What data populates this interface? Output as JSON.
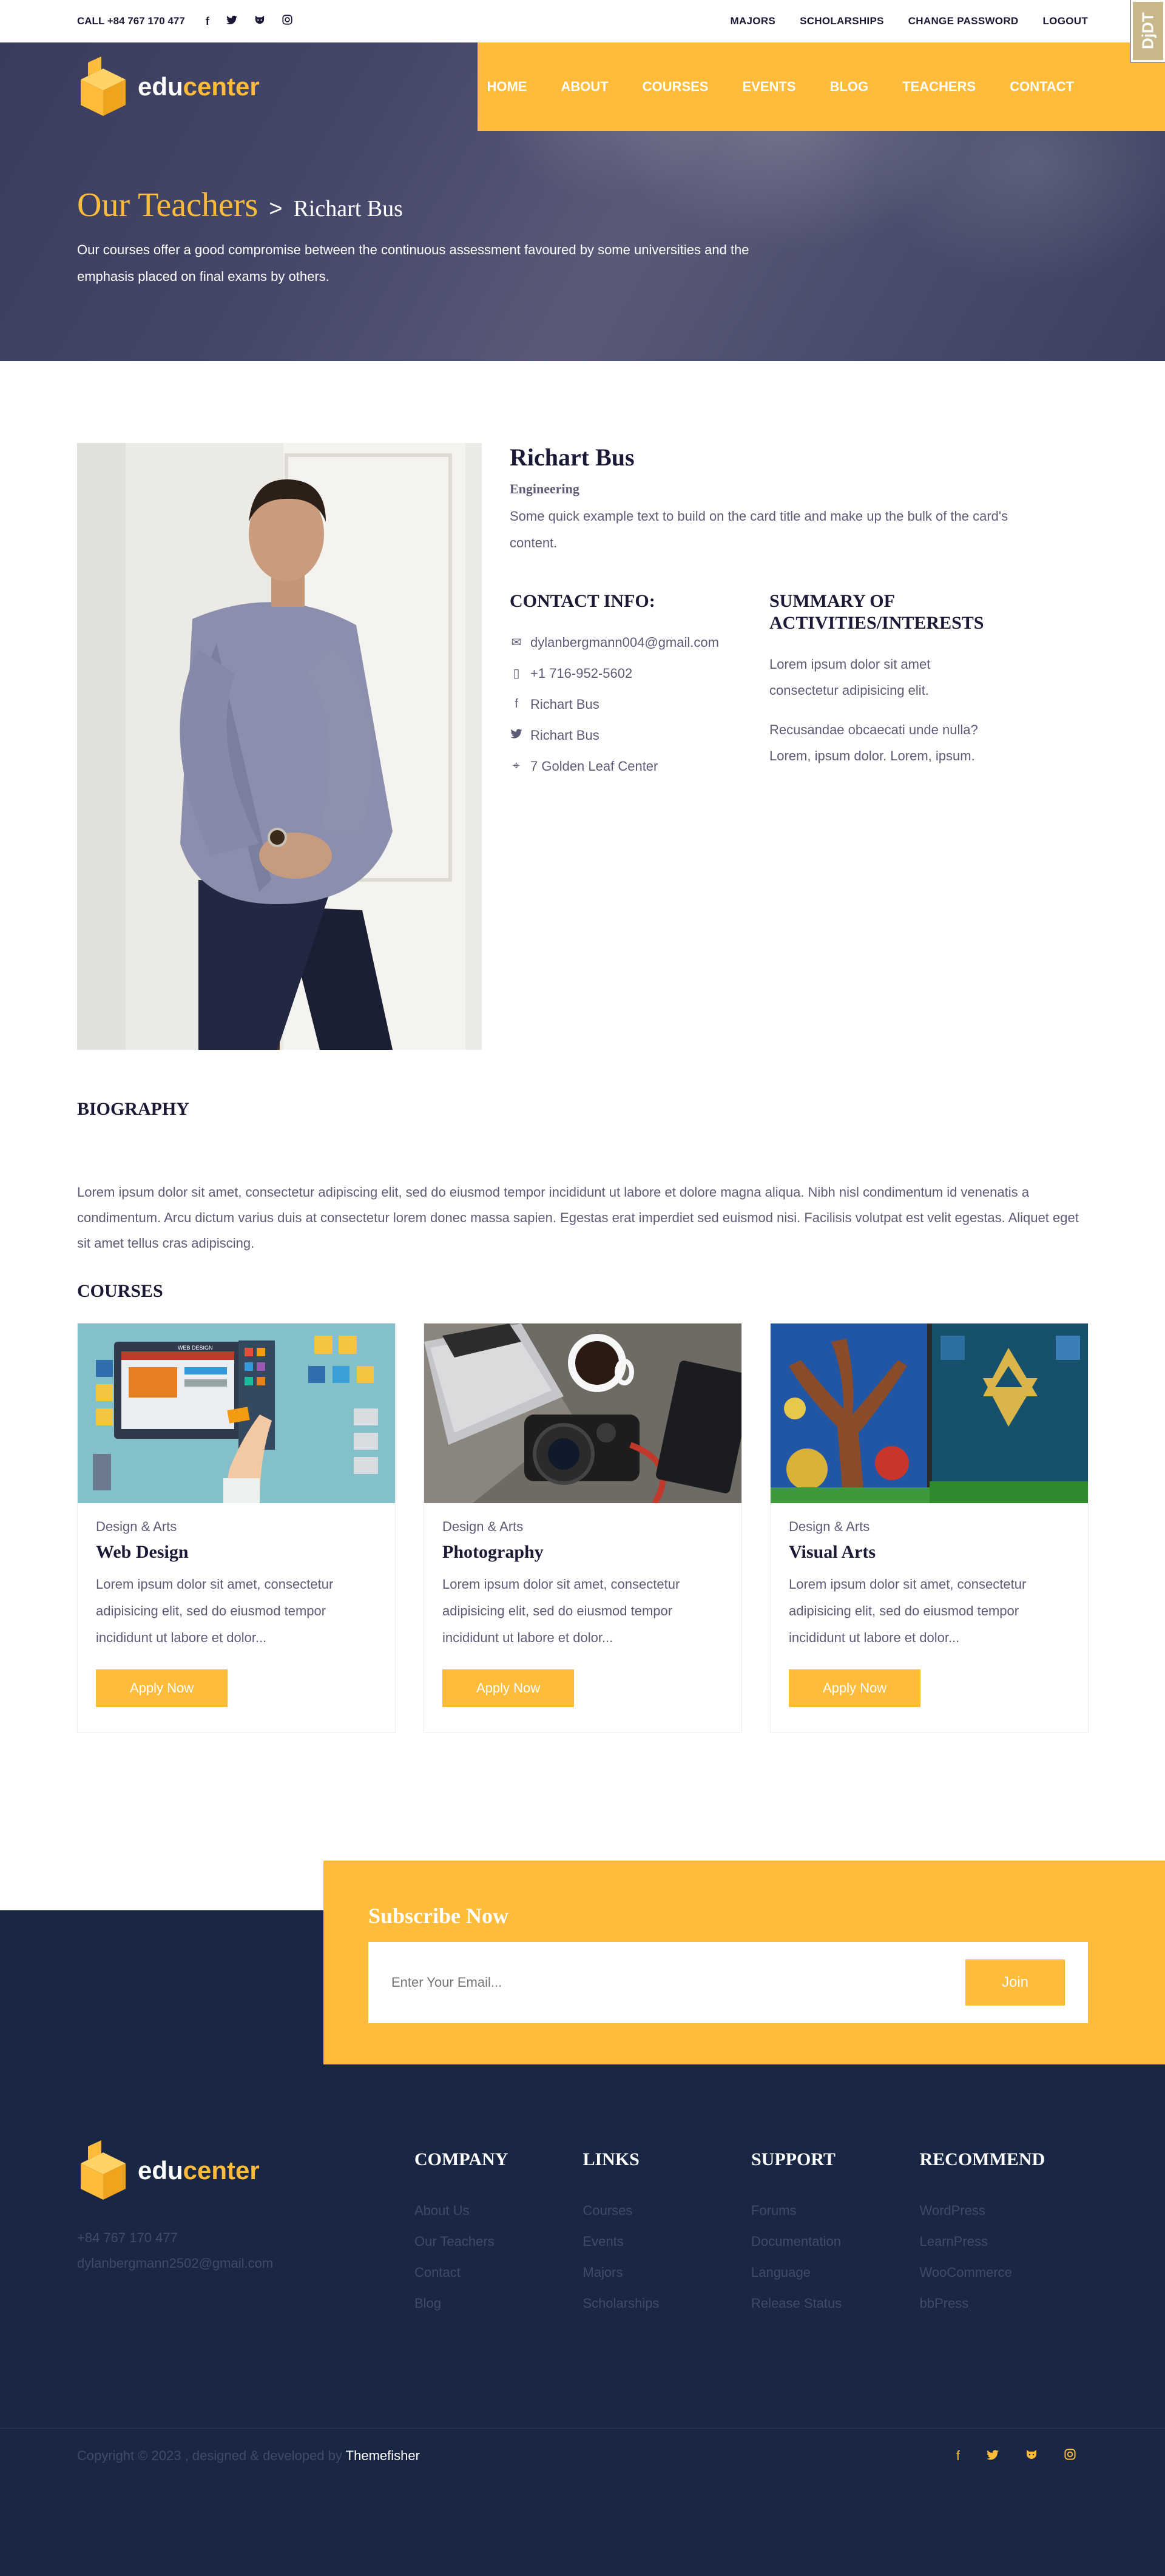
{
  "topbar": {
    "phone": "CALL +84 767 170 477",
    "social_icons": [
      "facebook-icon",
      "twitter-icon",
      "github-icon",
      "instagram-icon"
    ],
    "links": [
      "MAJORS",
      "SCHOLARSHIPS",
      "CHANGE PASSWORD",
      "LOGOUT"
    ],
    "debug_badge": "DjDT"
  },
  "brand": {
    "part1": "edu",
    "part2": "center"
  },
  "nav": [
    "HOME",
    "ABOUT",
    "COURSES",
    "EVENTS",
    "BLOG",
    "TEACHERS",
    "CONTACT"
  ],
  "hero": {
    "section": "Our Teachers",
    "separator": ">",
    "current": "Richart Bus",
    "description": "Our courses offer a good compromise between the continuous assessment favoured by some universities and the emphasis placed on final exams by others."
  },
  "teacher": {
    "name": "Richart Bus",
    "department": "Engineering",
    "intro": "Some quick example text to build on the card title and make up the bulk of the card's content.",
    "contact_heading": "CONTACT INFO:",
    "contact": [
      {
        "icon": "email-icon",
        "glyph": "✉",
        "text": "dylanbergmann004@gmail.com"
      },
      {
        "icon": "phone-icon",
        "glyph": "▯",
        "text": "+1 716-952-5602"
      },
      {
        "icon": "facebook-icon",
        "glyph": "f",
        "text": "Richart Bus"
      },
      {
        "icon": "twitter-icon",
        "glyph": "🐦",
        "text": "Richart Bus"
      },
      {
        "icon": "location-icon",
        "glyph": "⌖",
        "text": "7 Golden Leaf Center"
      }
    ],
    "summary_heading": "SUMMARY OF ACTIVITIES/INTERESTS",
    "summary": [
      "Lorem ipsum dolor sit amet consectetur adipisicing elit.",
      "Recusandae obcaecati unde nulla? Lorem, ipsum dolor. Lorem, ipsum."
    ]
  },
  "biography": {
    "heading": "BIOGRAPHY",
    "text": "Lorem ipsum dolor sit amet, consectetur adipiscing elit, sed do eiusmod tempor incididunt ut labore et dolore magna aliqua. Nibh nisl condimentum id venenatis a condimentum. Arcu dictum varius duis at consectetur lorem donec massa sapien. Egestas erat imperdiet sed euismod nisi. Facilisis volutpat est velit egestas. Aliquet eget sit amet tellus cras adipiscing."
  },
  "courses": {
    "heading": "COURSES",
    "items": [
      {
        "category": "Design & Arts",
        "title": "Web Design",
        "description": "Lorem ipsum dolor sit amet, consectetur adipisicing elit, sed do eiusmod tempor incididunt ut labore et dolor...",
        "button": "Apply Now",
        "thumb_screen_label": "WEB DESIGN"
      },
      {
        "category": "Design & Arts",
        "title": "Photography",
        "description": "Lorem ipsum dolor sit amet, consectetur adipisicing elit, sed do eiusmod tempor incididunt ut labore et dolor...",
        "button": "Apply Now"
      },
      {
        "category": "Design & Arts",
        "title": "Visual Arts",
        "description": "Lorem ipsum dolor sit amet, consectetur adipisicing elit, sed do eiusmod tempor incididunt ut labore et dolor...",
        "button": "Apply Now"
      }
    ]
  },
  "subscribe": {
    "heading": "Subscribe Now",
    "placeholder": "Enter Your Email...",
    "button": "Join"
  },
  "footer": {
    "phone": "+84 767 170 477",
    "email": "dylanbergmann2502@gmail.com",
    "columns": [
      {
        "heading": "COMPANY",
        "links": [
          "About Us",
          "Our Teachers",
          "Contact",
          "Blog"
        ]
      },
      {
        "heading": "LINKS",
        "links": [
          "Courses",
          "Events",
          "Majors",
          "Scholarships"
        ]
      },
      {
        "heading": "SUPPORT",
        "links": [
          "Forums",
          "Documentation",
          "Language",
          "Release Status"
        ]
      },
      {
        "heading": "RECOMMEND",
        "links": [
          "WordPress",
          "LearnPress",
          "WooCommerce",
          "bbPress"
        ]
      }
    ],
    "copyright": "Copyright © 2023 , designed & developed by",
    "credit": "Themefisher",
    "social_icons": [
      "facebook-icon",
      "twitter-icon",
      "github-icon",
      "instagram-icon"
    ]
  },
  "colors": {
    "accent": "#ffbc3b",
    "navy": "#1a2744",
    "dark_text": "#1a1a37",
    "body_text": "#5c5c77"
  }
}
